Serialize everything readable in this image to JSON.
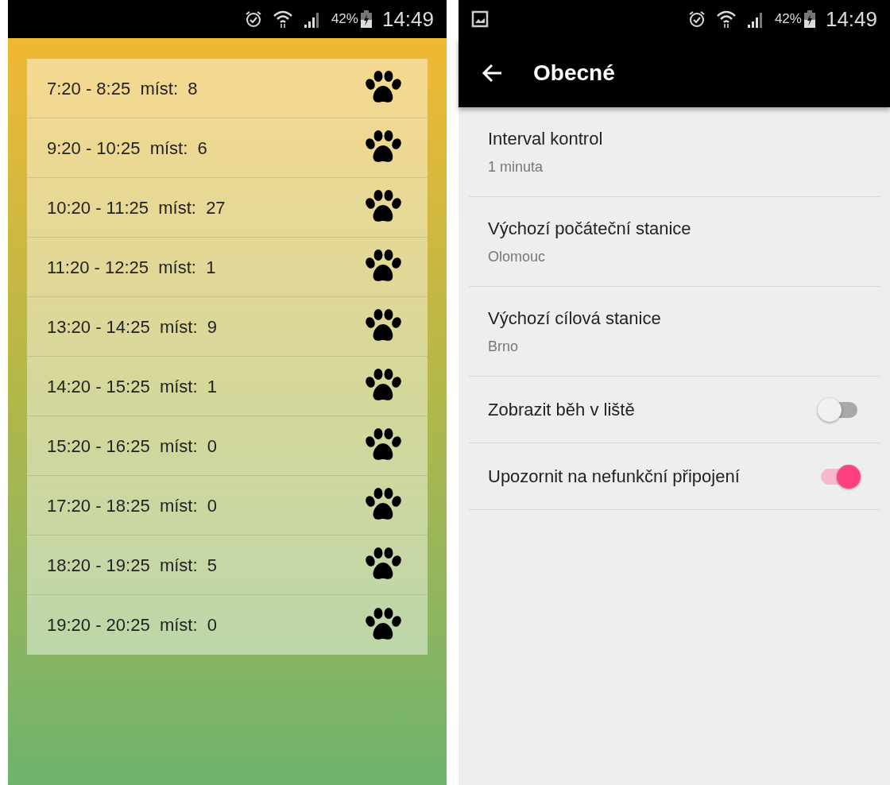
{
  "left_screen": {
    "status_bar": {
      "battery": "42%",
      "time": "14:49"
    },
    "slots": [
      {
        "time": "7:20 - 8:25",
        "label": "míst:",
        "count": "8"
      },
      {
        "time": "9:20 - 10:25",
        "label": "míst:",
        "count": "6"
      },
      {
        "time": "10:20 - 11:25",
        "label": "míst:",
        "count": "27"
      },
      {
        "time": "11:20 - 12:25",
        "label": "míst:",
        "count": "1"
      },
      {
        "time": "13:20 - 14:25",
        "label": "míst:",
        "count": "9"
      },
      {
        "time": "14:20 - 15:25",
        "label": "míst:",
        "count": "1"
      },
      {
        "time": "15:20 - 16:25",
        "label": "míst:",
        "count": "0"
      },
      {
        "time": "17:20 - 18:25",
        "label": "míst:",
        "count": "0"
      },
      {
        "time": "18:20 - 19:25",
        "label": "míst:",
        "count": "5"
      },
      {
        "time": "19:20 - 20:25",
        "label": "míst:",
        "count": "0"
      }
    ]
  },
  "right_screen": {
    "status_bar": {
      "battery": "42%",
      "time": "14:49"
    },
    "toolbar": {
      "title": "Obecné"
    },
    "settings": [
      {
        "kind": "value",
        "title": "Interval kontrol",
        "summary": "1 minuta"
      },
      {
        "kind": "value",
        "title": "Výchozí počáteční stanice",
        "summary": "Olomouc"
      },
      {
        "kind": "value",
        "title": "Výchozí cílová stanice",
        "summary": "Brno"
      },
      {
        "kind": "switch",
        "title": "Zobrazit běh v liště",
        "on": false
      },
      {
        "kind": "switch",
        "title": "Upozornit na nefunkční připojení",
        "on": true
      }
    ]
  }
}
